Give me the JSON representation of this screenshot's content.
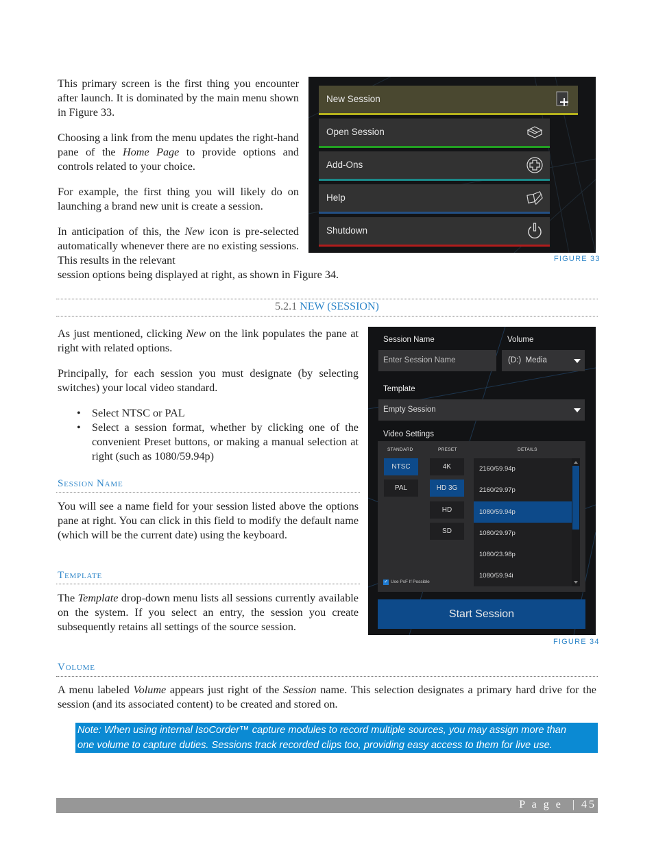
{
  "intro": {
    "p1": "This primary screen is the first thing you encounter after launch.  It is dominated by the main menu shown in Figure 33.",
    "p2_a": "Choosing a link from the menu updates the right-hand pane of the ",
    "p2_em": "Home Page",
    "p2_b": " to provide options and controls related to your choice.",
    "p3": "For example, the first thing you will likely do on launching a brand new unit is create a session.",
    "p4_a": "In anticipation of this, the ",
    "p4_em": "New",
    "p4_b": " icon is pre-selected automatically whenever there are no existing sessions.  This results in the relevant",
    "p4_c": "session options being displayed at right, as shown in Figure 34."
  },
  "figure33": {
    "caption": "FIGURE 33",
    "menu": [
      {
        "label": "New Session",
        "icon": "new-session-icon",
        "color": "#b5b11c",
        "selected": true
      },
      {
        "label": "Open Session",
        "icon": "open-session-box-icon",
        "color": "#22a022"
      },
      {
        "label": "Add-Ons",
        "icon": "add-ons-plus-circle-icon",
        "color": "#1b8a8a"
      },
      {
        "label": "Help",
        "icon": "help-book-icon",
        "color": "#234f84"
      },
      {
        "label": "Shutdown",
        "icon": "power-icon",
        "color": "#b01c1c"
      }
    ]
  },
  "section": {
    "number": "5.2.1",
    "title": "NEW (SESSION)"
  },
  "new_session": {
    "p1_a": "As just mentioned, clicking ",
    "p1_em": "New",
    "p1_b": " on the link populates the pane at right with related options.",
    "p2": "Principally, for each session you must designate (by selecting switches) your local video standard.",
    "bullets": [
      "Select NTSC or PAL",
      "Select a session format, whether by clicking one of the convenient Preset buttons, or making a manual selection at right (such as 1080/59.94p)"
    ]
  },
  "session_name": {
    "heading": "Session Name",
    "text": "You will see a name field for your session listed above the options pane at right. You can click in this field to modify the default name (which will be the current date) using the keyboard."
  },
  "template": {
    "heading": "Template",
    "text_a": "The ",
    "text_em": "Template",
    "text_b": " drop-down menu lists all sessions currently available on the system. If you select an entry, the session you create subsequently retains all settings of the source session."
  },
  "volume": {
    "heading": "Volume",
    "text_a": "A menu labeled ",
    "text_em1": "Volume",
    "text_b": " appears just right of the ",
    "text_em2": "Session",
    "text_c": " name.  This selection designates a primary hard drive for the session (and its associated content) to be created and stored on."
  },
  "figure34": {
    "caption": "FIGURE 34",
    "session_name_label": "Session Name",
    "session_name_placeholder": "Enter Session Name",
    "volume_label": "Volume",
    "volume_value": "(D:)  Media",
    "template_label": "Template",
    "template_value": "Empty Session",
    "video_settings_label": "Video Settings",
    "standard_header": "STANDARD",
    "preset_header": "PRESET",
    "details_header": "DETAILS",
    "standards": [
      {
        "label": "NTSC",
        "selected": true
      },
      {
        "label": "PAL",
        "selected": false
      }
    ],
    "presets": [
      {
        "label": "4K",
        "selected": false
      },
      {
        "label": "HD 3G",
        "selected": true
      },
      {
        "label": "HD",
        "selected": false
      },
      {
        "label": "SD",
        "selected": false
      }
    ],
    "details": [
      {
        "label": "2160/59.94p",
        "selected": false
      },
      {
        "label": "2160/29.97p",
        "selected": false
      },
      {
        "label": "1080/59.94p",
        "selected": true
      },
      {
        "label": "1080/29.97p",
        "selected": false
      },
      {
        "label": "1080/23.98p",
        "selected": false
      },
      {
        "label": "1080/59.94i",
        "selected": false
      }
    ],
    "psf_checkbox_label": "Use PsF If Possible",
    "psf_checked": true,
    "start_button": "Start Session"
  },
  "note": {
    "line1": "Note: When using internal IsoCorder™ capture modules to record multiple sources, you may assign more than",
    "line2": "one volume to capture duties.  Sessions track recorded clips too, providing easy access to them for live use."
  },
  "footer": {
    "page_label": "P a g e  | 45"
  }
}
